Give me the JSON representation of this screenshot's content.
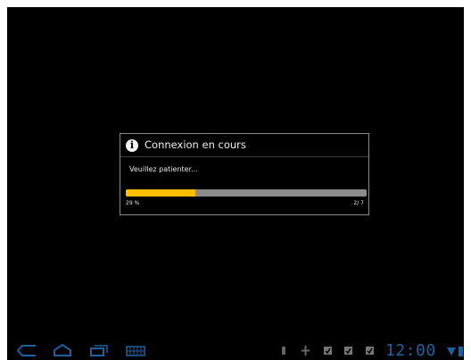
{
  "dialog": {
    "title": "Connexion en cours",
    "message": "Veuillez patienter...",
    "progress_fraction": 0.29,
    "percent_label": "29 %",
    "count_label": "2/ 7",
    "icon": "info-icon"
  },
  "system_bar": {
    "time": "12:00",
    "nav_icons": [
      "back-icon",
      "home-icon",
      "recent-apps-icon",
      "keyboard-icon"
    ],
    "status_icons": [
      "usb-icon",
      "usb-debug-icon",
      "notification-icon",
      "notification-icon",
      "notification-icon",
      "wifi-icon",
      "battery-icon"
    ]
  },
  "colors": {
    "progress_fill": "#ffbf00",
    "progress_track": "#8b8b8b",
    "system_icons": "#1f5f9e"
  }
}
